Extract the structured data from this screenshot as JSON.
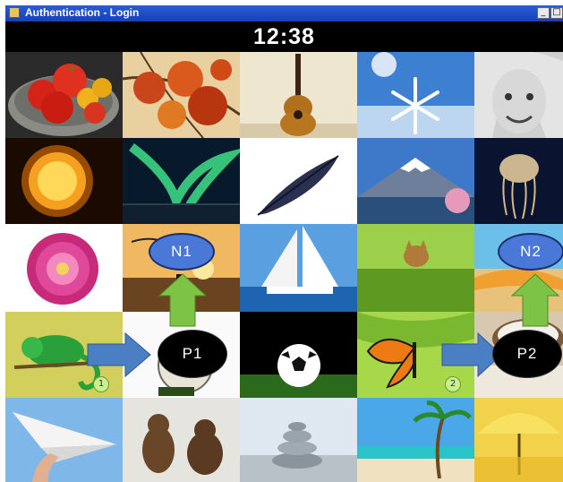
{
  "window": {
    "title": "Authentication - Login",
    "minimize_glyph": "_",
    "maximize_glyph": "□"
  },
  "clock": "12:38",
  "tiles": [
    {
      "row": 0,
      "col": 0,
      "icon": "tomato-basket"
    },
    {
      "row": 0,
      "col": 1,
      "icon": "autumn-leaves"
    },
    {
      "row": 0,
      "col": 2,
      "icon": "guitar"
    },
    {
      "row": 0,
      "col": 3,
      "icon": "snowflake"
    },
    {
      "row": 0,
      "col": 4,
      "icon": "girl-face"
    },
    {
      "row": 1,
      "col": 0,
      "icon": "sun"
    },
    {
      "row": 1,
      "col": 1,
      "icon": "aurora"
    },
    {
      "row": 1,
      "col": 2,
      "icon": "feather"
    },
    {
      "row": 1,
      "col": 3,
      "icon": "mount-fuji"
    },
    {
      "row": 1,
      "col": 4,
      "icon": "jellyfish"
    },
    {
      "row": 2,
      "col": 0,
      "icon": "dahlia-flower"
    },
    {
      "row": 2,
      "col": 1,
      "icon": "beach-sunset-fisherman"
    },
    {
      "row": 2,
      "col": 2,
      "icon": "sailboat"
    },
    {
      "row": 2,
      "col": 3,
      "icon": "kitten-in-grass"
    },
    {
      "row": 2,
      "col": 4,
      "icon": "beach-boat"
    },
    {
      "row": 3,
      "col": 0,
      "icon": "chameleon"
    },
    {
      "row": 3,
      "col": 1,
      "icon": "compass"
    },
    {
      "row": 3,
      "col": 2,
      "icon": "soccer-ball"
    },
    {
      "row": 3,
      "col": 3,
      "icon": "butterfly"
    },
    {
      "row": 3,
      "col": 4,
      "icon": "salt-bowl"
    },
    {
      "row": 4,
      "col": 0,
      "icon": "paper-plane"
    },
    {
      "row": 4,
      "col": 1,
      "icon": "bear-cubs"
    },
    {
      "row": 4,
      "col": 2,
      "icon": "stacked-stones"
    },
    {
      "row": 4,
      "col": 3,
      "icon": "palm-beach"
    },
    {
      "row": 4,
      "col": 4,
      "icon": "yellow-umbrella"
    }
  ],
  "annotations": {
    "n1": "N1",
    "n2": "N2",
    "p1": "P1",
    "p2": "P2",
    "badge1": "1",
    "badge2": "2"
  },
  "colors": {
    "highlight_red": "#d81a1a",
    "highlight_green": "#7bd03a",
    "highlight_yellow": "#e6e61e",
    "arrow_blue": "#4a7fc4",
    "arrow_green": "#7dc346",
    "oval_blue": "#4a78d6"
  }
}
